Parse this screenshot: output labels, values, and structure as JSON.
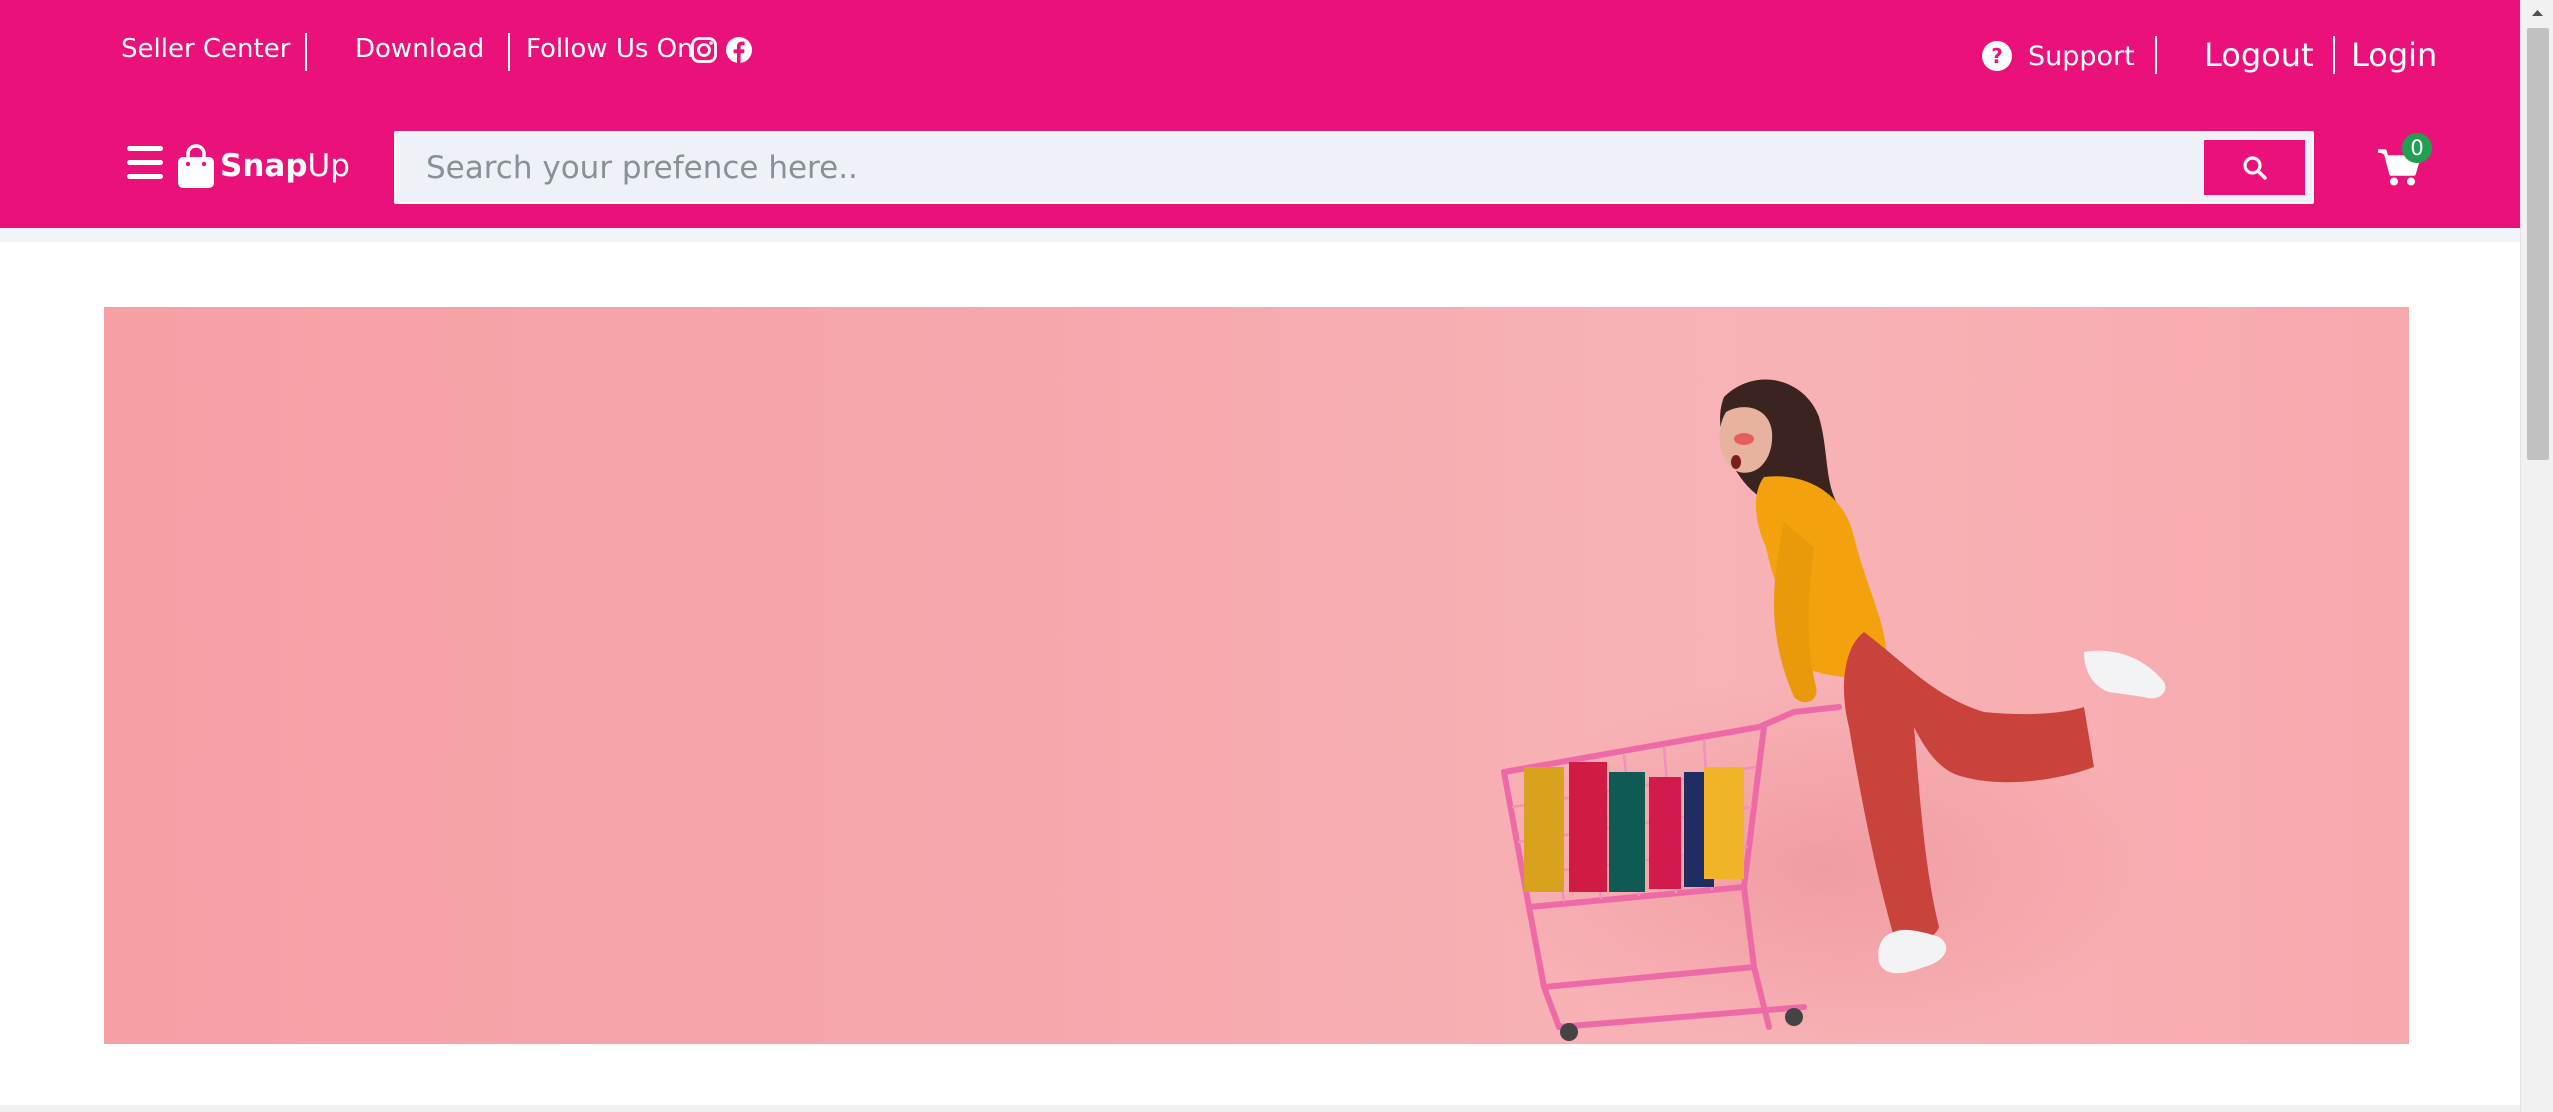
{
  "topbar": {
    "seller_center": "Seller Center",
    "download": "Download",
    "follow_us": "Follow Us On",
    "social_icons": [
      "instagram-icon",
      "facebook-icon"
    ],
    "support": "Support",
    "logout": "Logout",
    "login": "Login"
  },
  "brand": {
    "name_bold": "Snap",
    "name_light": "Up",
    "icons": [
      "menu-icon",
      "shopping-bag-icon"
    ]
  },
  "search": {
    "placeholder": "Search your prefence here..",
    "button_icon": "search-icon"
  },
  "cart": {
    "count": "0",
    "icon": "cart-icon"
  },
  "colors": {
    "brand_pink": "#ea117a",
    "badge_green": "#22a052",
    "banner_pink": "#f6a0a6"
  },
  "banner": {
    "image": "woman-with-shopping-cart"
  }
}
